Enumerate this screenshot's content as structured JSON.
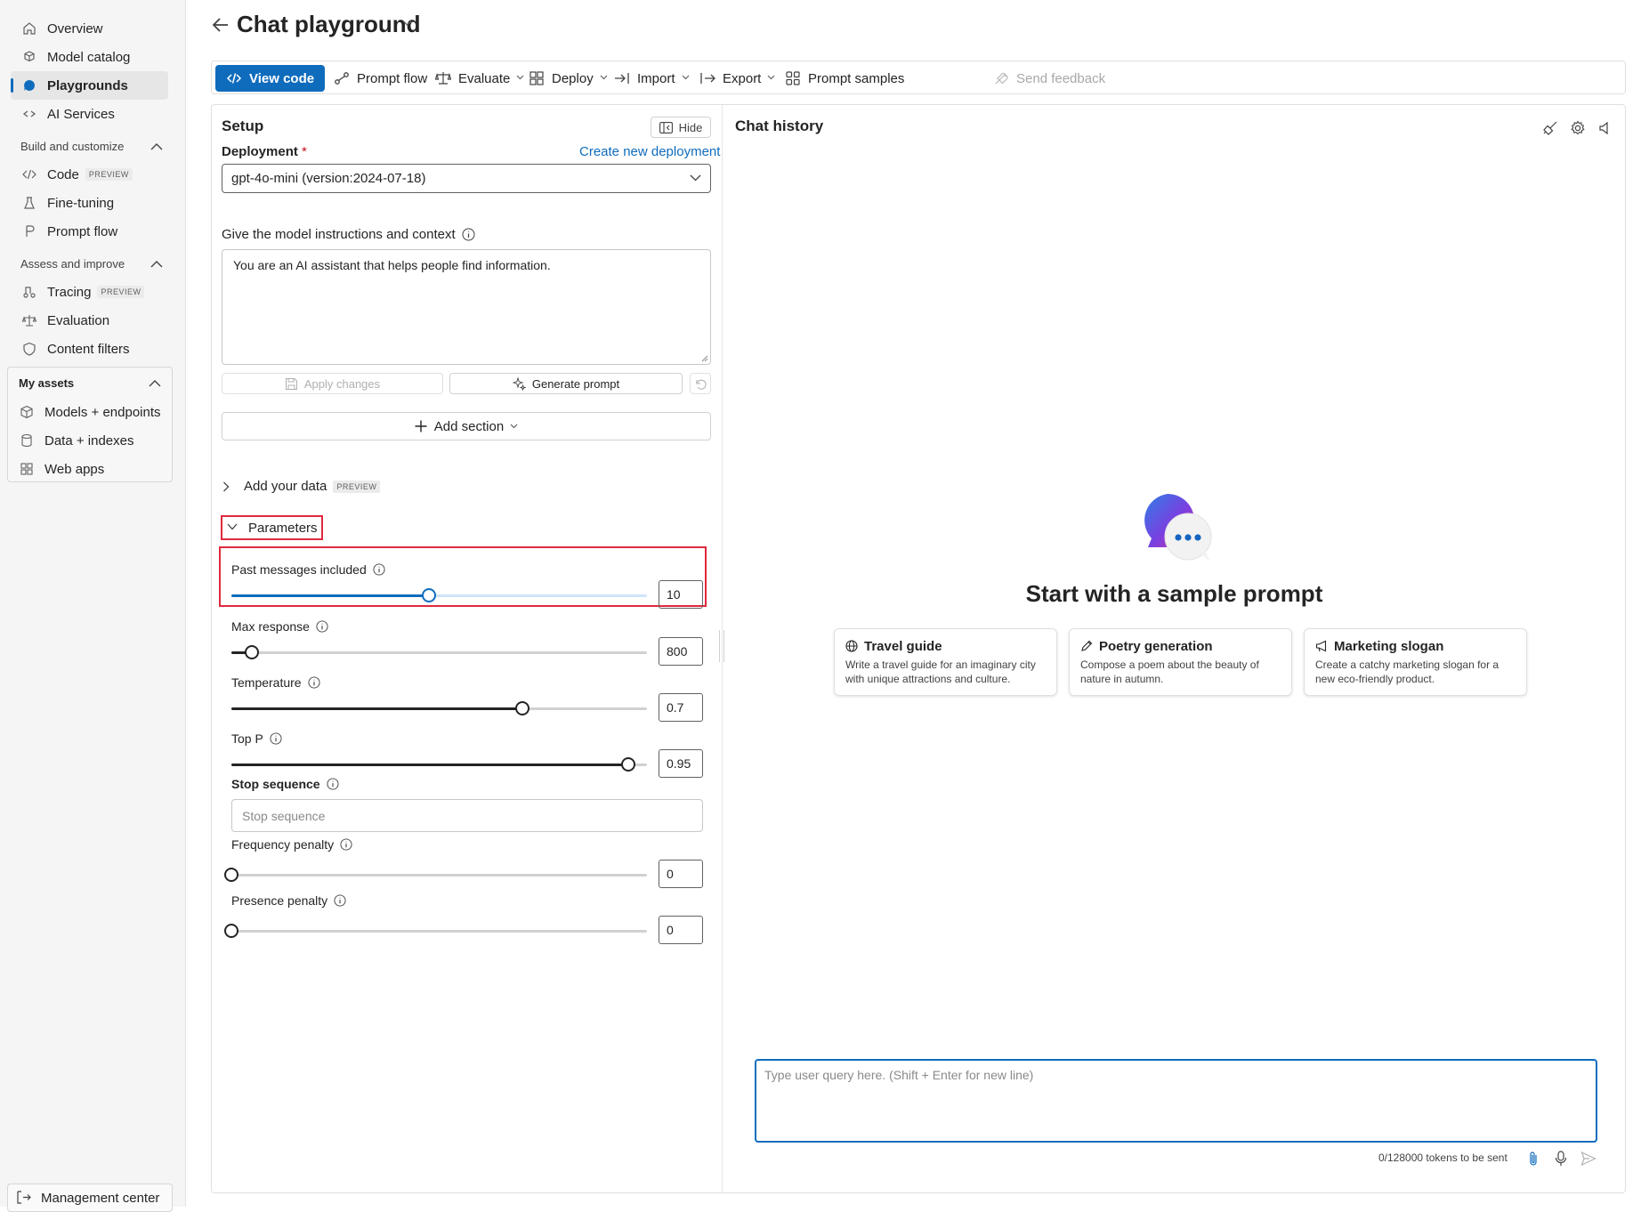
{
  "sidebar": {
    "top_items": [
      {
        "label": "Overview",
        "icon": "home-icon"
      },
      {
        "label": "Model catalog",
        "icon": "cube-stack-icon"
      },
      {
        "label": "Playgrounds",
        "icon": "chat-bubble-icon",
        "active": true
      },
      {
        "label": "AI Services",
        "icon": "link-icon"
      }
    ],
    "build_section": {
      "label": "Build and customize",
      "items": [
        {
          "label": "Code",
          "badge": "PREVIEW",
          "icon": "code-icon"
        },
        {
          "label": "Fine-tuning",
          "icon": "flask-icon"
        },
        {
          "label": "Prompt flow",
          "icon": "flow-icon"
        }
      ]
    },
    "assess_section": {
      "label": "Assess and improve",
      "items": [
        {
          "label": "Tracing",
          "badge": "PREVIEW",
          "icon": "tracing-icon"
        },
        {
          "label": "Evaluation",
          "icon": "scale-icon"
        },
        {
          "label": "Content filters",
          "icon": "shield-icon"
        }
      ]
    },
    "assets_section": {
      "label": "My assets",
      "items": [
        {
          "label": "Models + endpoints",
          "icon": "cube-icon"
        },
        {
          "label": "Data + indexes",
          "icon": "database-icon"
        },
        {
          "label": "Web apps",
          "icon": "grid-icon"
        }
      ]
    },
    "management": {
      "label": "Management center",
      "icon": "sign-out-icon"
    }
  },
  "header": {
    "title": "Chat playground"
  },
  "toolbar": {
    "view_code": "View code",
    "prompt_flow": "Prompt flow",
    "evaluate": "Evaluate",
    "deploy": "Deploy",
    "import": "Import",
    "export": "Export",
    "prompt_samples": "Prompt samples",
    "send_feedback": "Send feedback"
  },
  "setup": {
    "title": "Setup",
    "hide": "Hide",
    "deployment_label": "Deployment",
    "required_mark": "*",
    "create_link": "Create new deployment",
    "deployment_value": "gpt-4o-mini (version:2024-07-18)",
    "instructions_label": "Give the model instructions and context",
    "instructions_value": "You are an AI assistant that helps people find information.",
    "apply_changes": "Apply changes",
    "generate_prompt": "Generate prompt",
    "add_section": "Add section",
    "add_data": "Add your data",
    "add_data_badge": "PREVIEW",
    "parameters": "Parameters"
  },
  "parameters": {
    "past_messages": {
      "label": "Past messages included",
      "value": "10",
      "level": 0.475
    },
    "max_response": {
      "label": "Max response",
      "value": "800",
      "level": 0.05
    },
    "temperature": {
      "label": "Temperature",
      "value": "0.7",
      "level": 0.7
    },
    "top_p": {
      "label": "Top P",
      "value": "0.95",
      "level": 0.955
    },
    "stop_sequence": {
      "label": "Stop sequence",
      "placeholder": "Stop sequence"
    },
    "frequency_penalty": {
      "label": "Frequency penalty",
      "value": "0",
      "level": 0
    },
    "presence_penalty": {
      "label": "Presence penalty",
      "value": "0",
      "level": 0
    }
  },
  "chat": {
    "title": "Chat history",
    "empty_heading": "Start with a sample prompt",
    "cards": [
      {
        "title": "Travel guide",
        "desc": "Write a travel guide for an imaginary city with unique attractions and culture.",
        "icon": "globe-icon"
      },
      {
        "title": "Poetry generation",
        "desc": "Compose a poem about the beauty of nature in autumn.",
        "icon": "pen-icon"
      },
      {
        "title": "Marketing slogan",
        "desc": "Create a catchy marketing slogan for a new eco-friendly product.",
        "icon": "megaphone-icon"
      }
    ],
    "input_placeholder": "Type user query here. (Shift + Enter for new line)",
    "token_count": "0/128000 tokens to be sent"
  },
  "colors": {
    "accent": "#0f6cbd",
    "highlight_border": "#e0293d",
    "sidebar_bg": "#f5f5f5"
  }
}
